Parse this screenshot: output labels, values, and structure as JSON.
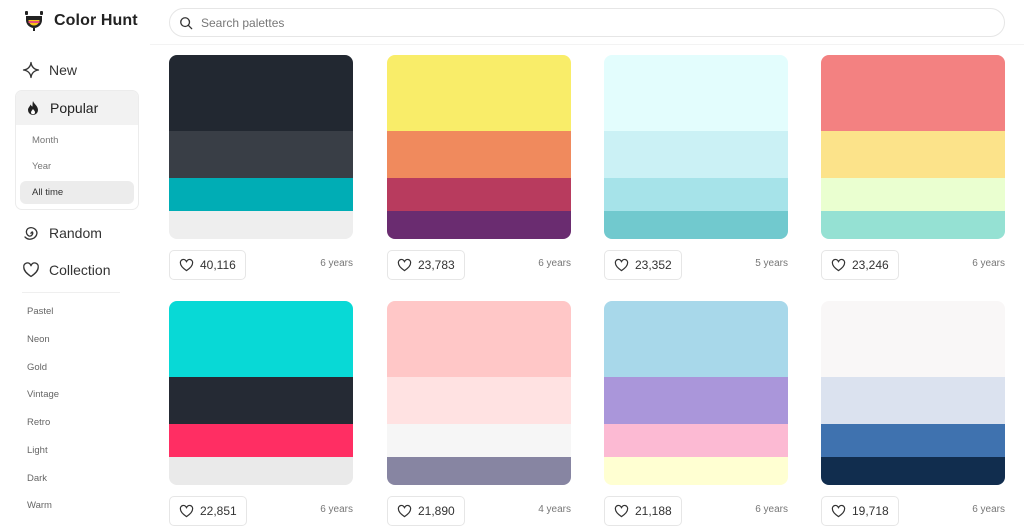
{
  "app": {
    "title": "Color Hunt"
  },
  "search": {
    "placeholder": "Search palettes"
  },
  "sidebar": {
    "new_label": "New",
    "popular": {
      "label": "Popular",
      "options": [
        "Month",
        "Year",
        "All time"
      ],
      "selected": "All time"
    },
    "random_label": "Random",
    "collection_label": "Collection",
    "tags": [
      "Pastel",
      "Neon",
      "Gold",
      "Vintage",
      "Retro",
      "Light",
      "Dark",
      "Warm"
    ]
  },
  "palettes": [
    {
      "likes": "40,116",
      "age": "6 years",
      "colors": [
        "#222831",
        "#393E46",
        "#00ADB5",
        "#EEEEEE"
      ]
    },
    {
      "likes": "23,783",
      "age": "6 years",
      "colors": [
        "#F9ED69",
        "#F08A5D",
        "#B83B5E",
        "#6A2C70"
      ]
    },
    {
      "likes": "23,352",
      "age": "5 years",
      "colors": [
        "#E3FDFD",
        "#CBF1F5",
        "#A6E3E9",
        "#71C9CE"
      ]
    },
    {
      "likes": "23,246",
      "age": "6 years",
      "colors": [
        "#F38181",
        "#FCE38A",
        "#EAFFD0",
        "#95E1D3"
      ]
    },
    {
      "likes": "22,851",
      "age": "6 years",
      "colors": [
        "#08D9D6",
        "#252A34",
        "#FF2E63",
        "#EAEAEA"
      ]
    },
    {
      "likes": "21,890",
      "age": "4 years",
      "colors": [
        "#FFC7C7",
        "#FFE2E2",
        "#F6F6F6",
        "#8785A2"
      ]
    },
    {
      "likes": "21,188",
      "age": "6 years",
      "colors": [
        "#A8D8EA",
        "#AA96DA",
        "#FCBAD3",
        "#FFFFD2"
      ]
    },
    {
      "likes": "19,718",
      "age": "6 years",
      "colors": [
        "#F9F7F7",
        "#DBE2EF",
        "#3F72AF",
        "#112D4E"
      ]
    }
  ]
}
